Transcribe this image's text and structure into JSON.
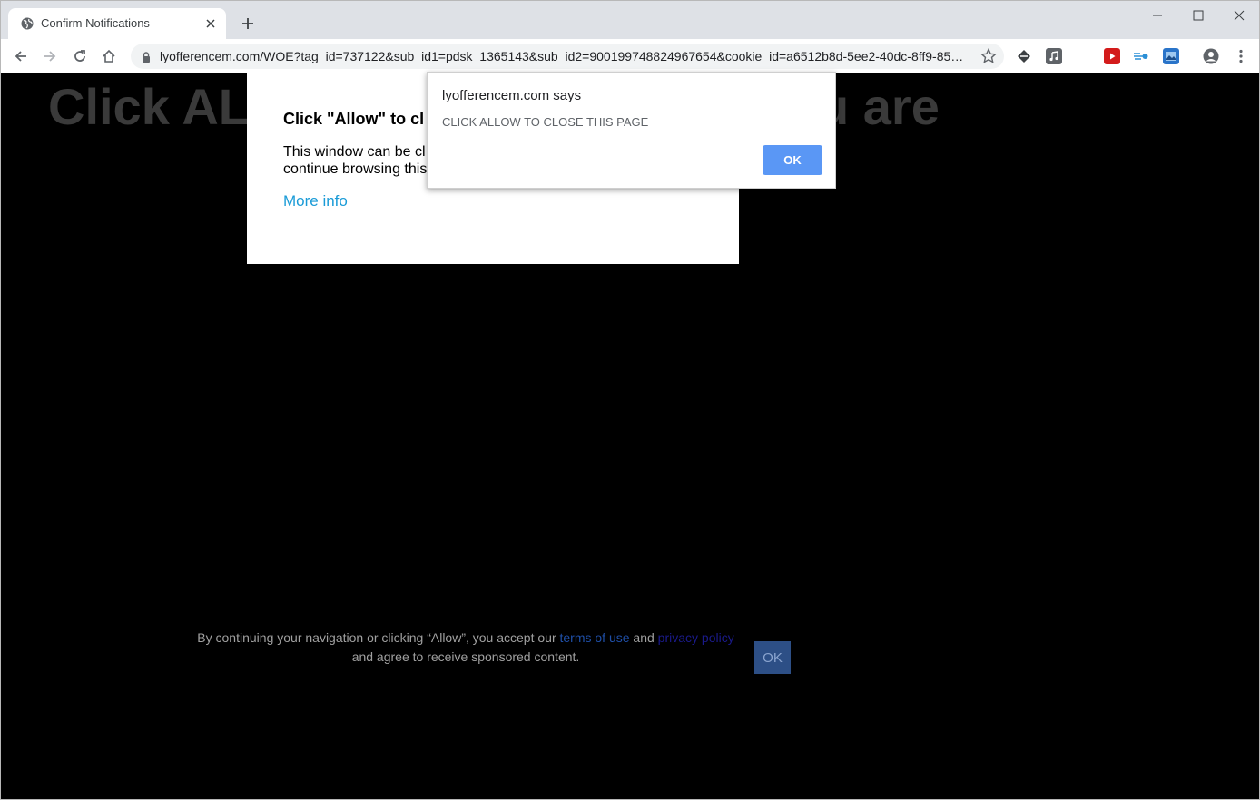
{
  "tab": {
    "title": "Confirm Notifications"
  },
  "address_bar": {
    "url": "lyofferencem.com/WOE?tag_id=737122&sub_id1=pdsk_1365143&sub_id2=900199748824967654&cookie_id=a6512b8d-5ee2-40dc-8ff9-859..."
  },
  "page": {
    "bg_heading_left": "Click AL",
    "bg_heading_right": "u are",
    "notification_box": {
      "title": "Click \"Allow\" to cl",
      "text_line1": "This window can be cl",
      "text_line2": "continue browsing this",
      "more_info": "More info"
    },
    "consent": {
      "text_before": "By continuing your navigation or clicking “Allow”, you accept our",
      "link_terms": "terms of use",
      "text_and": "and",
      "link_privacy": "privacy policy",
      "text_after": "and agree to receive sponsored content.",
      "ok_label": "OK"
    }
  },
  "alert": {
    "title": "lyofferencem.com says",
    "message": "CLICK ALLOW TO CLOSE THIS PAGE",
    "ok_label": "OK"
  },
  "colors": {
    "accent": "#5a97f5",
    "link": "#1a9bd7",
    "background": "#000000"
  }
}
